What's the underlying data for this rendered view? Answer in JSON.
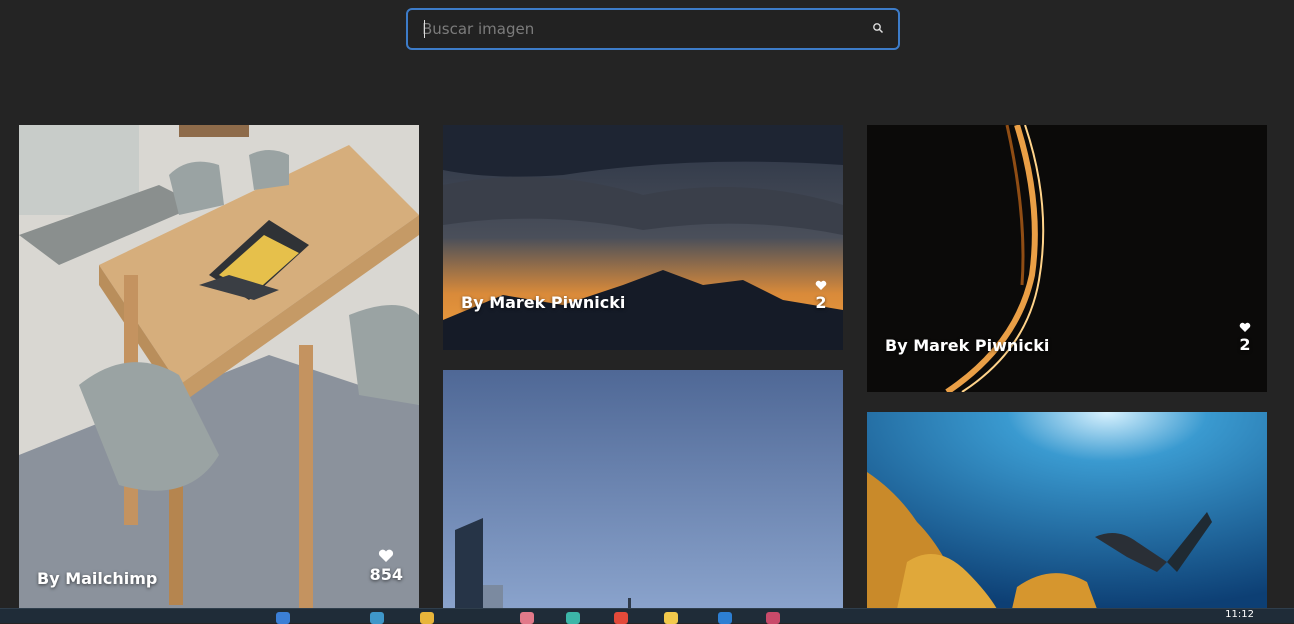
{
  "search": {
    "placeholder": "Buscar imagen",
    "value": ""
  },
  "cards": [
    {
      "author": "By Mailchimp",
      "likes": "854"
    },
    {
      "author": "By Marek Piwnicki",
      "likes": "2"
    },
    {
      "author": "By Marek Piwnicki",
      "likes": "2"
    }
  ],
  "taskbar": {
    "clock": "11:12"
  },
  "colors": {
    "background": "#242424",
    "search_border": "#3d7cc9",
    "text": "#ffffff"
  }
}
